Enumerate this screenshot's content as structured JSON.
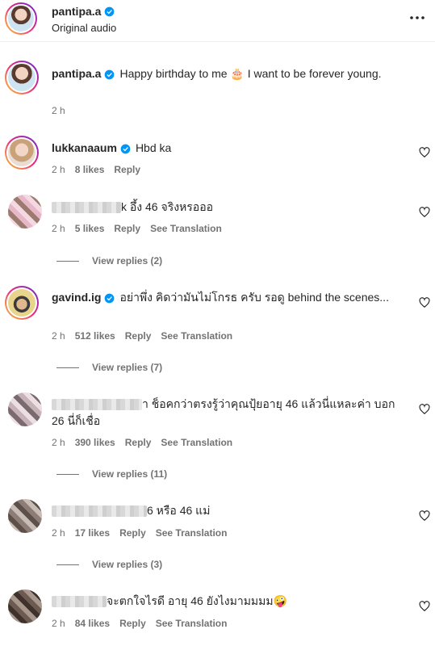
{
  "header": {
    "username": "pantipa.a",
    "subtitle": "Original audio"
  },
  "caption": {
    "username": "pantipa.a",
    "text": "Happy birthday to me 🎂 I want to be forever young.",
    "time": "2 h"
  },
  "comments": [
    {
      "username": "lukkanaaum",
      "text": "Hbd ka",
      "time": "2 h",
      "likes": "8 likes",
      "reply": "Reply",
      "see_translation": ""
    },
    {
      "username": "",
      "text": "k อึ้ง 46 จริงหรอออ",
      "time": "2 h",
      "likes": "5 likes",
      "reply": "Reply",
      "see_translation": "See Translation",
      "view_replies": "View replies (2)"
    },
    {
      "username": "gavind.ig",
      "text": "อย่าพึ่ง คิดว่ามันไม่โกรธ ครับ รอดู behind the scenes...",
      "time": "2 h",
      "likes": "512 likes",
      "reply": "Reply",
      "see_translation": "See Translation",
      "view_replies": "View replies (7)"
    },
    {
      "username": "",
      "text": "า ช็อคกว่าตรงรู้ว่าคุณปุ้ยอายุ 46 แล้วนี่แหละค่า บอก 26 นี่ก็เชื่อ",
      "time": "2 h",
      "likes": "390 likes",
      "reply": "Reply",
      "see_translation": "See Translation",
      "view_replies": "View replies (11)"
    },
    {
      "username": "",
      "text": "6 หรือ 46 แม่",
      "time": "2 h",
      "likes": "17 likes",
      "reply": "Reply",
      "see_translation": "See Translation",
      "view_replies": "View replies (3)"
    },
    {
      "username": "",
      "text": "จะตกใจไรดี อายุ 46 ยังไงมามมมม🤪",
      "time": "2 h",
      "likes": "84 likes",
      "reply": "Reply",
      "see_translation": "See Translation"
    }
  ],
  "icons": {
    "verified": "verified-badge-icon",
    "more": "more-options-icon",
    "heart": "heart-outline-icon"
  },
  "colors": {
    "verified": "#0095f6",
    "meta": "#737373",
    "text": "#262626"
  }
}
